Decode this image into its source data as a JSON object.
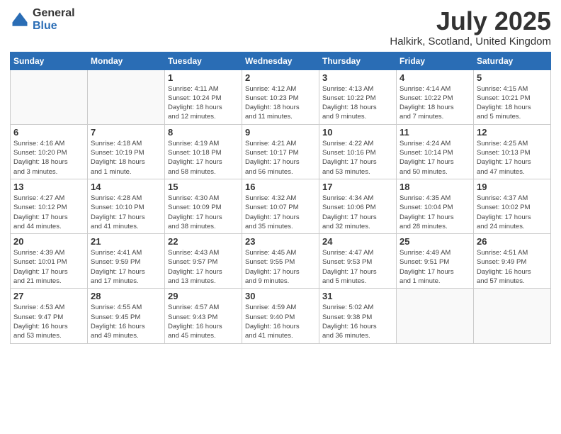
{
  "header": {
    "logo_general": "General",
    "logo_blue": "Blue",
    "month_title": "July 2025",
    "location": "Halkirk, Scotland, United Kingdom"
  },
  "days_of_week": [
    "Sunday",
    "Monday",
    "Tuesday",
    "Wednesday",
    "Thursday",
    "Friday",
    "Saturday"
  ],
  "weeks": [
    [
      {
        "day": "",
        "info": ""
      },
      {
        "day": "",
        "info": ""
      },
      {
        "day": "1",
        "info": "Sunrise: 4:11 AM\nSunset: 10:24 PM\nDaylight: 18 hours\nand 12 minutes."
      },
      {
        "day": "2",
        "info": "Sunrise: 4:12 AM\nSunset: 10:23 PM\nDaylight: 18 hours\nand 11 minutes."
      },
      {
        "day": "3",
        "info": "Sunrise: 4:13 AM\nSunset: 10:22 PM\nDaylight: 18 hours\nand 9 minutes."
      },
      {
        "day": "4",
        "info": "Sunrise: 4:14 AM\nSunset: 10:22 PM\nDaylight: 18 hours\nand 7 minutes."
      },
      {
        "day": "5",
        "info": "Sunrise: 4:15 AM\nSunset: 10:21 PM\nDaylight: 18 hours\nand 5 minutes."
      }
    ],
    [
      {
        "day": "6",
        "info": "Sunrise: 4:16 AM\nSunset: 10:20 PM\nDaylight: 18 hours\nand 3 minutes."
      },
      {
        "day": "7",
        "info": "Sunrise: 4:18 AM\nSunset: 10:19 PM\nDaylight: 18 hours\nand 1 minute."
      },
      {
        "day": "8",
        "info": "Sunrise: 4:19 AM\nSunset: 10:18 PM\nDaylight: 17 hours\nand 58 minutes."
      },
      {
        "day": "9",
        "info": "Sunrise: 4:21 AM\nSunset: 10:17 PM\nDaylight: 17 hours\nand 56 minutes."
      },
      {
        "day": "10",
        "info": "Sunrise: 4:22 AM\nSunset: 10:16 PM\nDaylight: 17 hours\nand 53 minutes."
      },
      {
        "day": "11",
        "info": "Sunrise: 4:24 AM\nSunset: 10:14 PM\nDaylight: 17 hours\nand 50 minutes."
      },
      {
        "day": "12",
        "info": "Sunrise: 4:25 AM\nSunset: 10:13 PM\nDaylight: 17 hours\nand 47 minutes."
      }
    ],
    [
      {
        "day": "13",
        "info": "Sunrise: 4:27 AM\nSunset: 10:12 PM\nDaylight: 17 hours\nand 44 minutes."
      },
      {
        "day": "14",
        "info": "Sunrise: 4:28 AM\nSunset: 10:10 PM\nDaylight: 17 hours\nand 41 minutes."
      },
      {
        "day": "15",
        "info": "Sunrise: 4:30 AM\nSunset: 10:09 PM\nDaylight: 17 hours\nand 38 minutes."
      },
      {
        "day": "16",
        "info": "Sunrise: 4:32 AM\nSunset: 10:07 PM\nDaylight: 17 hours\nand 35 minutes."
      },
      {
        "day": "17",
        "info": "Sunrise: 4:34 AM\nSunset: 10:06 PM\nDaylight: 17 hours\nand 32 minutes."
      },
      {
        "day": "18",
        "info": "Sunrise: 4:35 AM\nSunset: 10:04 PM\nDaylight: 17 hours\nand 28 minutes."
      },
      {
        "day": "19",
        "info": "Sunrise: 4:37 AM\nSunset: 10:02 PM\nDaylight: 17 hours\nand 24 minutes."
      }
    ],
    [
      {
        "day": "20",
        "info": "Sunrise: 4:39 AM\nSunset: 10:01 PM\nDaylight: 17 hours\nand 21 minutes."
      },
      {
        "day": "21",
        "info": "Sunrise: 4:41 AM\nSunset: 9:59 PM\nDaylight: 17 hours\nand 17 minutes."
      },
      {
        "day": "22",
        "info": "Sunrise: 4:43 AM\nSunset: 9:57 PM\nDaylight: 17 hours\nand 13 minutes."
      },
      {
        "day": "23",
        "info": "Sunrise: 4:45 AM\nSunset: 9:55 PM\nDaylight: 17 hours\nand 9 minutes."
      },
      {
        "day": "24",
        "info": "Sunrise: 4:47 AM\nSunset: 9:53 PM\nDaylight: 17 hours\nand 5 minutes."
      },
      {
        "day": "25",
        "info": "Sunrise: 4:49 AM\nSunset: 9:51 PM\nDaylight: 17 hours\nand 1 minute."
      },
      {
        "day": "26",
        "info": "Sunrise: 4:51 AM\nSunset: 9:49 PM\nDaylight: 16 hours\nand 57 minutes."
      }
    ],
    [
      {
        "day": "27",
        "info": "Sunrise: 4:53 AM\nSunset: 9:47 PM\nDaylight: 16 hours\nand 53 minutes."
      },
      {
        "day": "28",
        "info": "Sunrise: 4:55 AM\nSunset: 9:45 PM\nDaylight: 16 hours\nand 49 minutes."
      },
      {
        "day": "29",
        "info": "Sunrise: 4:57 AM\nSunset: 9:43 PM\nDaylight: 16 hours\nand 45 minutes."
      },
      {
        "day": "30",
        "info": "Sunrise: 4:59 AM\nSunset: 9:40 PM\nDaylight: 16 hours\nand 41 minutes."
      },
      {
        "day": "31",
        "info": "Sunrise: 5:02 AM\nSunset: 9:38 PM\nDaylight: 16 hours\nand 36 minutes."
      },
      {
        "day": "",
        "info": ""
      },
      {
        "day": "",
        "info": ""
      }
    ]
  ]
}
